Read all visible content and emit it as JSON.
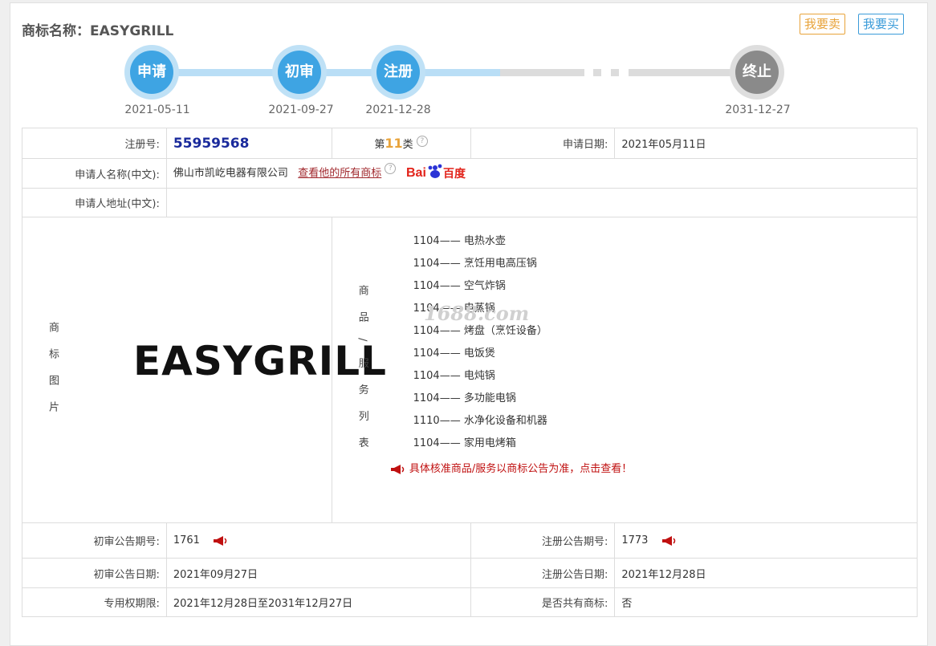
{
  "header": {
    "title": "商标名称：EASYGRILL",
    "sell_label": "我要卖",
    "buy_label": "我要买"
  },
  "timeline": [
    {
      "label": "申请",
      "date": "2021-05-11",
      "state": "done"
    },
    {
      "label": "初审",
      "date": "2021-09-27",
      "state": "done"
    },
    {
      "label": "注册",
      "date": "2021-12-28",
      "state": "done"
    },
    {
      "label": "终止",
      "date": "2031-12-27",
      "state": "future"
    }
  ],
  "details": {
    "reg_no_label": "注册号:",
    "reg_no": "55959568",
    "class_prefix": "第",
    "class_num": "11",
    "class_suffix": "类",
    "apply_date_label": "申请日期:",
    "apply_date": "2021年05月11日",
    "applicant_label": "申请人名称(中文):",
    "applicant": "佛山市凯屹电器有限公司",
    "all_marks_link": "查看他的所有商标",
    "baidu_text": "Bai度百度",
    "address_label": "申请人地址(中文):",
    "address": "",
    "mark_image_label": "商标图片",
    "mark_word": "EASYGRILL",
    "goods_label": "商品/服务列表",
    "goods": [
      {
        "code": "1104",
        "name": "电热水壶"
      },
      {
        "code": "1104",
        "name": "烹饪用电高压锅"
      },
      {
        "code": "1104",
        "name": "空气炸锅"
      },
      {
        "code": "1104",
        "name": "电蒸锅"
      },
      {
        "code": "1104",
        "name": "烤盘（烹饪设备）"
      },
      {
        "code": "1104",
        "name": "电饭煲"
      },
      {
        "code": "1104",
        "name": "电炖锅"
      },
      {
        "code": "1104",
        "name": "多功能电锅"
      },
      {
        "code": "1110",
        "name": "水净化设备和机器"
      },
      {
        "code": "1104",
        "name": "家用电烤箱"
      }
    ],
    "goods_notice": "具体核准商品/服务以商标公告为准，点击查看！",
    "prelim_issue_label": "初审公告期号:",
    "prelim_issue": "1761",
    "reg_issue_label": "注册公告期号:",
    "reg_issue": "1773",
    "prelim_date_label": "初审公告日期:",
    "prelim_date": "2021年09月27日",
    "reg_date_label": "注册公告日期:",
    "reg_date": "2021年12月28日",
    "term_label": "专用权期限:",
    "term": "2021年12月28日至2031年12月27日",
    "shared_label": "是否共有商标:",
    "shared": "否"
  },
  "watermark": "1688.com",
  "colors": {
    "blue": "#3ea4e3",
    "gray": "#8a8a8a",
    "orange": "#e8a33a",
    "red": "#c01010"
  }
}
